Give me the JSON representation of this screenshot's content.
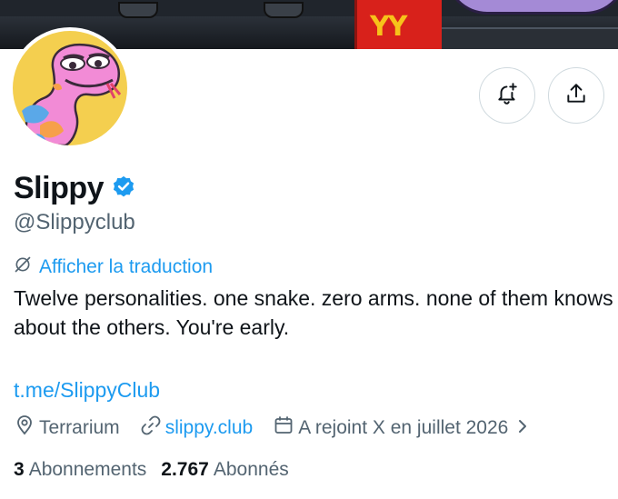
{
  "banner": {
    "box_logo": "YY"
  },
  "profile": {
    "display_name": "Slippy",
    "handle": "@Slippyclub",
    "translate_label": "Afficher la traduction",
    "bio": "Twelve personalities. one snake. zero arms. none of them knows about the others. You're early.",
    "link": "t.me/SlippyClub",
    "location": "Terrarium",
    "website": "slippy.club",
    "joined": "A rejoint X en juillet 2026",
    "following_count": "3",
    "following_label": "Abonnements",
    "followers_count": "2.767",
    "followers_label": "Abonnés"
  },
  "icons": {
    "notify": "bell-plus-icon",
    "share": "share-icon",
    "verified": "verified-badge-icon",
    "translate": "translate-icon",
    "location": "location-pin-icon",
    "website": "link-icon",
    "joined": "calendar-icon",
    "chevron": "chevron-right-icon"
  },
  "colors": {
    "accent": "#1d9bf0",
    "text": "#0f1419",
    "secondary": "#536471",
    "avatar_bg": "#f4cf4f"
  }
}
